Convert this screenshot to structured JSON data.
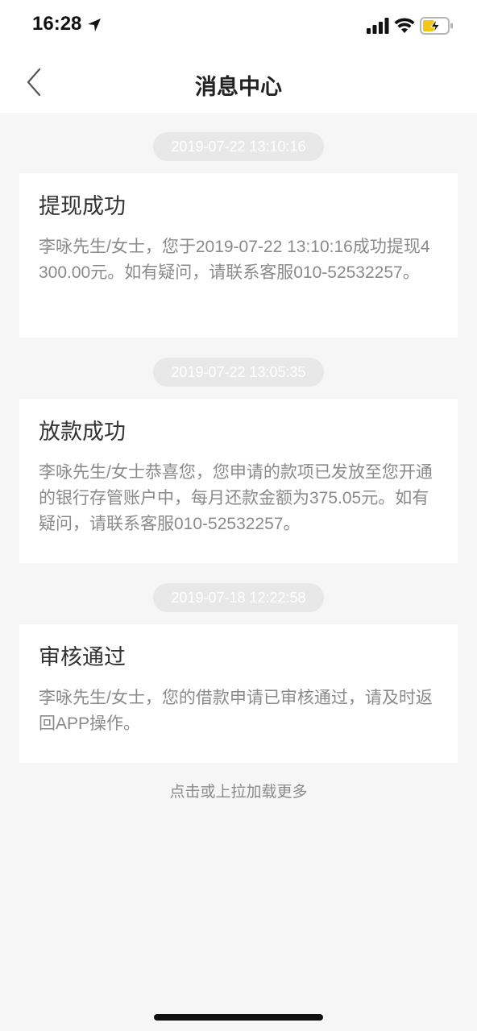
{
  "status_bar": {
    "time": "16:28",
    "battery_color": "#f5c518"
  },
  "nav": {
    "title": "消息中心"
  },
  "messages": [
    {
      "timestamp": "2019-07-22 13:10:16",
      "title": "提现成功",
      "body": "李咏先生/女士，您于2019-07-22 13:10:16成功提现4300.00元。如有疑问，请联系客服010-52532257。"
    },
    {
      "timestamp": "2019-07-22 13:05:35",
      "title": "放款成功",
      "body": "李咏先生/女士恭喜您，您申请的款项已发放至您开通的银行存管账户中，每月还款金额为375.05元。如有疑问，请联系客服010-52532257。"
    },
    {
      "timestamp": "2019-07-18 12:22:58",
      "title": "审核通过",
      "body": "李咏先生/女士，您的借款申请已审核通过，请及时返回APP操作。"
    }
  ],
  "load_more": "点击或上拉加载更多"
}
